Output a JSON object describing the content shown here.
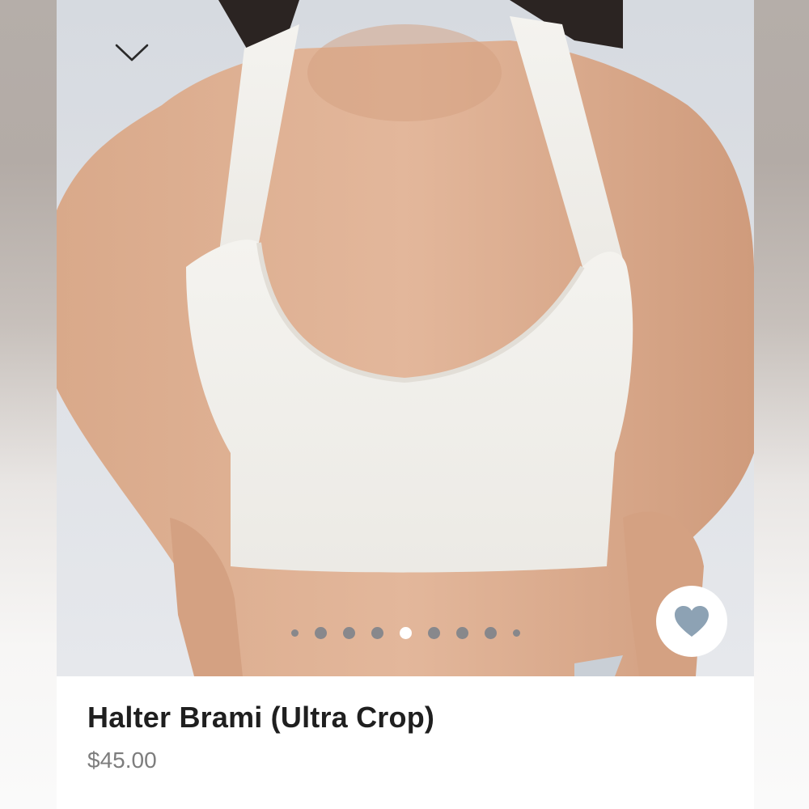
{
  "product": {
    "title": "Halter Brami (Ultra Crop)",
    "price": "$45.00"
  },
  "carousel": {
    "total_dots": 9,
    "active_index": 4
  },
  "icons": {
    "collapse": "chevron-down-icon",
    "favorite": "heart-icon"
  },
  "colors": {
    "heart": "#8da2b4",
    "price": "#7d7d7d",
    "title": "#1f1f1f",
    "dot_inactive": "#78808a",
    "dot_active": "#ffffff"
  }
}
